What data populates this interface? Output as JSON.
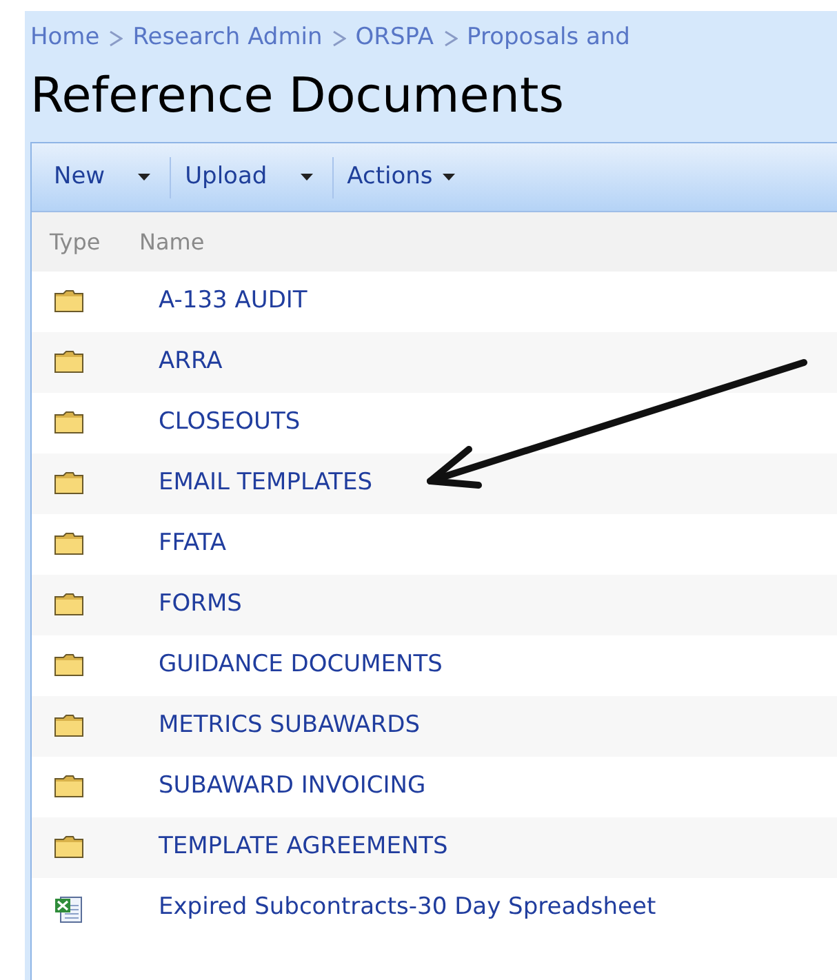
{
  "breadcrumb": [
    "Home",
    "Research Admin",
    "ORSPA",
    "Proposals and"
  ],
  "title": "Reference Documents",
  "toolbar": [
    {
      "label": "New",
      "dropdown": true
    },
    {
      "label": "Upload",
      "dropdown": true
    },
    {
      "label": "Actions",
      "dropdown": true
    }
  ],
  "columns": [
    "Type",
    "Name"
  ],
  "rows": [
    {
      "kind": "folder",
      "name": "A-133 AUDIT"
    },
    {
      "kind": "folder",
      "name": "ARRA"
    },
    {
      "kind": "folder",
      "name": "CLOSEOUTS"
    },
    {
      "kind": "folder",
      "name": "EMAIL TEMPLATES"
    },
    {
      "kind": "folder",
      "name": "FFATA"
    },
    {
      "kind": "folder",
      "name": "FORMS"
    },
    {
      "kind": "folder",
      "name": "GUIDANCE DOCUMENTS"
    },
    {
      "kind": "folder",
      "name": "METRICS SUBAWARDS"
    },
    {
      "kind": "folder",
      "name": "SUBAWARD INVOICING"
    },
    {
      "kind": "folder",
      "name": "TEMPLATE AGREEMENTS"
    },
    {
      "kind": "spreadsheet",
      "name": "Expired Subcontracts-30 Day Spreadsheet"
    }
  ]
}
